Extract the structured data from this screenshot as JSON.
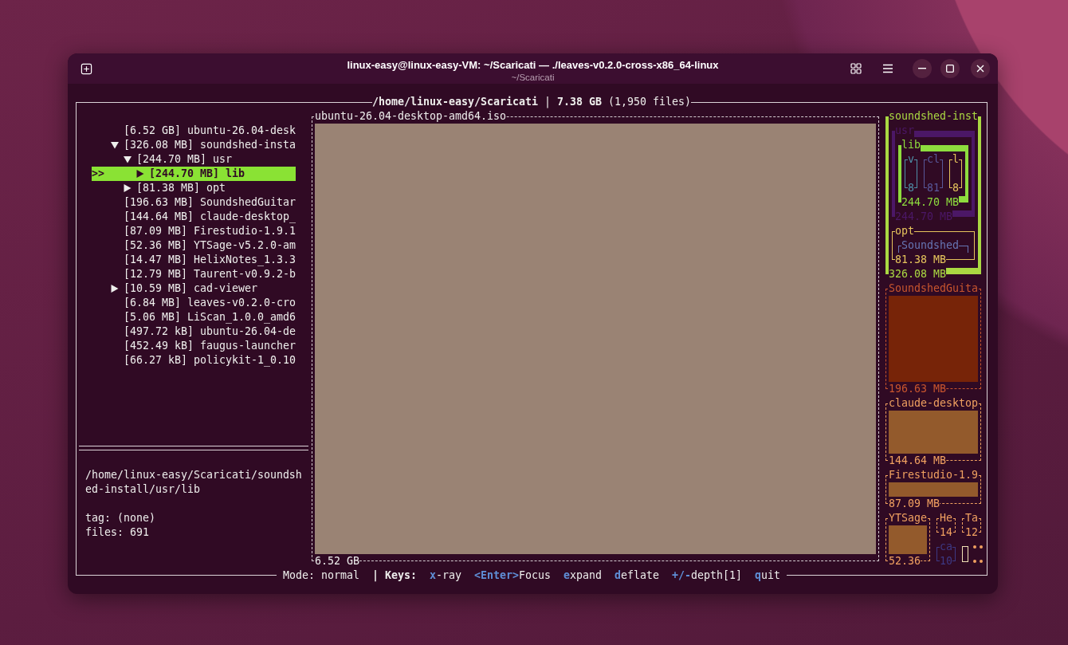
{
  "window": {
    "title": "linux-easy@linux-easy-VM: ~/Scaricati — ./leaves-v0.2.0-cross-x86_64-linux",
    "subtitle": "~/Scaricati"
  },
  "header": {
    "title": "**/home/linux-easy/Scaricati** | **7.38 GB** (1,950 files)"
  },
  "tree": {
    "cursor": ">>",
    "items": [
      {
        "kind": "file",
        "text": "[6.52 GB] ubuntu-26.04-desk",
        "selected": false
      },
      {
        "kind": "dir",
        "text": "[326.08 MB] soundshed-insta",
        "expanded": true,
        "selected": false,
        "children": [
          {
            "kind": "dir",
            "text": "[244.70 MB] usr",
            "expanded": true,
            "selected": false,
            "children": [
              {
                "kind": "dir",
                "text": "[244.70 MB] lib",
                "expanded": false,
                "selected": true
              }
            ]
          },
          {
            "kind": "dir",
            "text": "[81.38 MB] opt",
            "expanded": false,
            "selected": false
          }
        ]
      },
      {
        "kind": "file",
        "text": "[196.63 MB] SoundshedGuitar",
        "selected": false
      },
      {
        "kind": "file",
        "text": "[144.64 MB] claude-desktop_",
        "selected": false
      },
      {
        "kind": "file",
        "text": "[87.09 MB] Firestudio-1.9.1",
        "selected": false
      },
      {
        "kind": "file",
        "text": "[52.36 MB] YTSage-v5.2.0-am",
        "selected": false
      },
      {
        "kind": "file",
        "text": "[14.47 MB] HelixNotes_1.3.3",
        "selected": false
      },
      {
        "kind": "file",
        "text": "[12.79 MB] Taurent-v0.9.2-b",
        "selected": false
      },
      {
        "kind": "dir",
        "text": "[10.59 MB] cad-viewer",
        "expanded": false,
        "selected": false
      },
      {
        "kind": "file",
        "text": "[6.84 MB] leaves-v0.2.0-cro",
        "selected": false
      },
      {
        "kind": "file",
        "text": "[5.06 MB] LiScan_1.0.0_amd6",
        "selected": false
      },
      {
        "kind": "file",
        "text": "[497.72 kB] ubuntu-26.04-de",
        "selected": false
      },
      {
        "kind": "file",
        "text": "[452.49 kB] faugus-launcher",
        "selected": false
      },
      {
        "kind": "file",
        "text": "[66.27 kB] policykit-1_0.10",
        "selected": false
      }
    ]
  },
  "details": {
    "path": "/home/linux-easy/Scaricati/soundshed-install/usr/lib",
    "lines": [
      "tag: (none)",
      "files: 691"
    ]
  },
  "main_tile": {
    "name": "ubuntu-26.04-desktop-amd64.iso",
    "size": "6.52 GB",
    "color": "#9a8374"
  },
  "side_tiles": [
    {
      "kind": "focus",
      "name": "soundshed-inst",
      "size": "326.08 MB",
      "color": "#aad842",
      "children": [
        {
          "kind": "focus",
          "name": "usr",
          "size": "244.70 MB",
          "color": "#4b1766",
          "children": [
            {
              "kind": "focus",
              "name": "lib",
              "size": "244.70 MB",
              "color": "#8edc3e",
              "children": [
                {
                  "kind": "dir",
                  "name": "v",
                  "size": "8",
                  "color": "#4f8fa8"
                },
                {
                  "kind": "dir",
                  "name": "cl",
                  "size": "81",
                  "color": "#58589a"
                },
                {
                  "kind": "dir",
                  "name": "l",
                  "size": "8",
                  "color": "#e6c45c"
                }
              ]
            }
          ]
        },
        {
          "kind": "dir",
          "name": "opt",
          "size": "81.38 MB",
          "color": "#e6c45c",
          "children": [
            {
              "kind": "dir",
              "name": "Soundshed",
              "color": "#6676b4"
            }
          ]
        }
      ]
    },
    {
      "kind": "file",
      "name": "SoundshedGuita",
      "size": "196.63 MB",
      "color": "#c8552e"
    },
    {
      "kind": "file",
      "name": "claude-desktop",
      "size": "144.64 MB",
      "color": "#f0a060"
    },
    {
      "kind": "file",
      "name": "Firestudio-1.9",
      "size": "87.09 MB",
      "color": "#f0a060"
    },
    {
      "kind": "file",
      "name": "YTSage",
      "size": "52.36",
      "color": "#f0a060"
    },
    {
      "kind": "file",
      "name": "He",
      "size": "14",
      "color": "#f0a060"
    },
    {
      "kind": "file",
      "name": "Ta",
      "size": "12",
      "color": "#f0a060"
    },
    {
      "kind": "dir",
      "name": "ca",
      "size": "10",
      "color": "#3d3883"
    }
  ],
  "status_bar": {
    "mode": "Mode: normal",
    "separator": "|",
    "keys_label": "Keys:",
    "keys": [
      {
        "key": "x",
        "rest": "-ray"
      },
      {
        "key": "<Enter>",
        "rest": "Focus"
      },
      {
        "key": "e",
        "rest": "xpand"
      },
      {
        "key": "d",
        "rest": "eflate"
      },
      {
        "key": "+/-",
        "rest": "depth[1]"
      },
      {
        "key": "q",
        "rest": "uit"
      }
    ]
  }
}
